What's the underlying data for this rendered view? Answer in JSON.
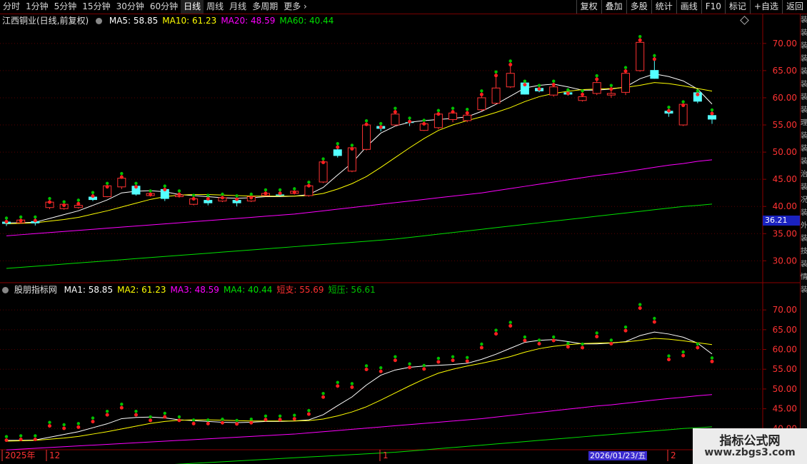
{
  "toolbar": {
    "periods": [
      "分时",
      "1分钟",
      "5分钟",
      "15分钟",
      "30分钟",
      "60分钟",
      "日线",
      "周线",
      "月线",
      "多周期",
      "更多 ›"
    ],
    "active_period": "日线",
    "tools": [
      "复权",
      "叠加",
      "多股",
      "统计",
      "画线",
      "F10",
      "标记",
      "+自选",
      "返回"
    ]
  },
  "main_panel": {
    "title": "江西铜业(日线,前复权)",
    "indicators": [
      {
        "label": "MA5: 58.85",
        "color": "#ffffff"
      },
      {
        "label": "MA10: 61.23",
        "color": "#ffff00"
      },
      {
        "label": "MA20: 48.59",
        "color": "#ff00ff"
      },
      {
        "label": "MA60: 40.44",
        "color": "#00e000"
      }
    ],
    "current_price_label": "36.21"
  },
  "sub_panel": {
    "title": "股朋指标网",
    "indicators": [
      {
        "label": "MA1: 58.85",
        "color": "#ffffff"
      },
      {
        "label": "MA2: 61.23",
        "color": "#ffff00"
      },
      {
        "label": "MA3: 48.59",
        "color": "#ff00ff"
      },
      {
        "label": "MA4: 40.44",
        "color": "#00e000"
      },
      {
        "label": "短支: 55.69",
        "color": "#ff3030"
      },
      {
        "label": "短压: 56.61",
        "color": "#00c000"
      }
    ]
  },
  "time_axis": {
    "labels": [
      "2025年",
      "12",
      "1",
      "2"
    ],
    "crosshair_date": "2026/01/23/五"
  },
  "side_strip_text": [
    "装",
    "装",
    "装",
    "装",
    "装",
    "装",
    "装",
    "装",
    "理",
    "装",
    "装",
    "装",
    "治",
    "装",
    "况",
    "装",
    "外",
    "装",
    "技",
    "装",
    "情",
    "装"
  ],
  "watermark": {
    "line1": "指标公式网",
    "line2": "www.zbgs3.com"
  },
  "colors": {
    "up": "#ff3232",
    "down": "#54ffff",
    "axis_text": "#ff3232",
    "grid": "#5a0000",
    "border": "#8b0000"
  },
  "chart_data": [
    {
      "type": "candlestick",
      "title": "江西铜业(日线,前复权)",
      "ylim": [
        26.5,
        73
      ],
      "yticks": [
        30,
        35,
        40,
        45,
        50,
        55,
        60,
        65,
        70
      ],
      "ohlc": [
        [
          37.2,
          37.6,
          36.4,
          36.8
        ],
        [
          37.0,
          37.8,
          36.8,
          37.5
        ],
        [
          37.3,
          37.8,
          36.5,
          36.9
        ],
        [
          39.8,
          41.2,
          39.5,
          40.8
        ],
        [
          39.6,
          40.6,
          39.4,
          40.4
        ],
        [
          39.8,
          40.9,
          39.6,
          40.2
        ],
        [
          41.8,
          42.3,
          41.0,
          41.2
        ],
        [
          41.8,
          44.0,
          41.7,
          43.8
        ],
        [
          43.6,
          45.8,
          43.2,
          45.2
        ],
        [
          43.8,
          44.0,
          42.0,
          42.2
        ],
        [
          42.0,
          42.6,
          41.8,
          42.4
        ],
        [
          43.2,
          43.5,
          41.0,
          41.4
        ],
        [
          41.8,
          42.6,
          41.6,
          42.1
        ],
        [
          40.4,
          41.8,
          40.2,
          41.4
        ],
        [
          41.2,
          41.8,
          40.2,
          40.6
        ],
        [
          41.0,
          42.0,
          40.8,
          41.6
        ],
        [
          41.2,
          41.7,
          40.0,
          40.6
        ],
        [
          41.0,
          42.0,
          40.8,
          41.8
        ],
        [
          42.0,
          42.8,
          41.9,
          42.4
        ],
        [
          42.2,
          42.8,
          41.8,
          42.0
        ],
        [
          42.4,
          43.0,
          42.2,
          42.8
        ],
        [
          42.0,
          44.2,
          41.8,
          43.8
        ],
        [
          44.5,
          48.5,
          44.3,
          48.2
        ],
        [
          50.5,
          51.3,
          49.0,
          49.3
        ],
        [
          46.5,
          51.0,
          46.3,
          50.8
        ],
        [
          50.5,
          55.5,
          50.3,
          55.0
        ],
        [
          54.8,
          55.0,
          53.8,
          54.3
        ],
        [
          55.0,
          57.8,
          54.8,
          57.0
        ],
        [
          55.5,
          56.0,
          54.8,
          55.4
        ],
        [
          54.0,
          55.6,
          53.9,
          55.2
        ],
        [
          54.5,
          57.4,
          54.2,
          57.0
        ],
        [
          56.0,
          57.8,
          55.5,
          57.2
        ],
        [
          55.8,
          57.6,
          55.5,
          56.8
        ],
        [
          57.8,
          61.0,
          57.5,
          60.0
        ],
        [
          59.0,
          64.5,
          58.8,
          61.8
        ],
        [
          62.0,
          66.5,
          61.8,
          64.5
        ],
        [
          62.8,
          62.8,
          60.6,
          60.6
        ],
        [
          61.8,
          62.0,
          61.0,
          61.2
        ],
        [
          60.5,
          62.8,
          60.2,
          62.0
        ],
        [
          61.0,
          61.2,
          60.4,
          60.6
        ],
        [
          59.5,
          61.0,
          59.3,
          60.2
        ],
        [
          60.8,
          63.8,
          60.5,
          62.8
        ],
        [
          60.5,
          62.0,
          60.0,
          60.8
        ],
        [
          61.0,
          65.3,
          60.5,
          64.5
        ],
        [
          65.0,
          71.0,
          64.8,
          70.2
        ],
        [
          65.1,
          67.5,
          63.5,
          63.5
        ],
        [
          57.6,
          58.0,
          56.5,
          57.1
        ],
        [
          55.0,
          59.0,
          54.8,
          58.8
        ],
        [
          61.0,
          61.0,
          59.0,
          59.3
        ],
        [
          56.8,
          57.5,
          55.2,
          56.0
        ]
      ],
      "ma": [
        {
          "name": "MA5",
          "color": "#ffffff",
          "values": [
            37.0,
            37.0,
            37.1,
            37.8,
            38.5,
            39.2,
            40.2,
            41.2,
            42.5,
            42.8,
            42.9,
            42.7,
            42.2,
            42.0,
            41.8,
            41.6,
            41.5,
            41.6,
            41.8,
            41.8,
            41.9,
            42.2,
            43.5,
            45.8,
            48.0,
            51.0,
            53.5,
            54.8,
            55.5,
            55.8,
            56.0,
            56.2,
            56.5,
            57.5,
            58.8,
            60.3,
            61.8,
            62.3,
            62.5,
            62.0,
            61.4,
            61.4,
            61.6,
            62.0,
            63.5,
            64.4,
            63.9,
            63.1,
            61.6,
            58.85
          ]
        },
        {
          "name": "MA10",
          "color": "#ffff00",
          "values": [
            36.8,
            36.9,
            37.0,
            37.3,
            37.6,
            38.0,
            38.6,
            39.2,
            39.9,
            40.6,
            41.3,
            41.8,
            42.1,
            42.2,
            42.2,
            42.1,
            42.0,
            41.9,
            41.9,
            41.9,
            41.9,
            42.0,
            42.4,
            43.2,
            44.2,
            45.5,
            47.2,
            49.0,
            50.8,
            52.5,
            54.0,
            55.0,
            55.8,
            56.5,
            57.3,
            58.2,
            59.3,
            60.2,
            60.8,
            61.2,
            61.5,
            61.6,
            61.7,
            61.9,
            62.3,
            62.8,
            62.6,
            62.2,
            61.7,
            61.23
          ]
        },
        {
          "name": "MA20",
          "color": "#ff00ff",
          "values": [
            34.6,
            34.8,
            35.0,
            35.2,
            35.4,
            35.6,
            35.8,
            36.0,
            36.2,
            36.4,
            36.6,
            36.8,
            37.0,
            37.2,
            37.4,
            37.6,
            37.8,
            38.0,
            38.2,
            38.4,
            38.6,
            38.9,
            39.2,
            39.5,
            39.8,
            40.1,
            40.4,
            40.7,
            41.0,
            41.3,
            41.6,
            41.9,
            42.2,
            42.5,
            42.9,
            43.3,
            43.7,
            44.1,
            44.5,
            44.9,
            45.3,
            45.7,
            46.0,
            46.4,
            46.8,
            47.2,
            47.6,
            47.9,
            48.3,
            48.59
          ]
        },
        {
          "name": "MA60",
          "color": "#00e000",
          "values": [
            28.6,
            28.8,
            29.0,
            29.2,
            29.4,
            29.6,
            29.8,
            30.0,
            30.2,
            30.4,
            30.6,
            30.8,
            31.0,
            31.2,
            31.4,
            31.6,
            31.8,
            32.0,
            32.2,
            32.4,
            32.6,
            32.8,
            33.0,
            33.2,
            33.4,
            33.6,
            33.8,
            34.0,
            34.3,
            34.6,
            34.9,
            35.2,
            35.5,
            35.8,
            36.1,
            36.4,
            36.7,
            37.0,
            37.3,
            37.6,
            37.9,
            38.2,
            38.5,
            38.8,
            39.1,
            39.4,
            39.7,
            40.0,
            40.2,
            40.44
          ]
        }
      ]
    },
    {
      "type": "line",
      "title": "股朋指标网",
      "ylim": [
        35,
        74
      ],
      "yticks": [
        40,
        45,
        50,
        55,
        60,
        65,
        70
      ],
      "series": [
        {
          "name": "MA1",
          "color": "#ffffff"
        },
        {
          "name": "MA2",
          "color": "#ffff00"
        },
        {
          "name": "MA3",
          "color": "#ff00ff"
        },
        {
          "name": "MA4",
          "color": "#00e000"
        }
      ],
      "markers": "short-term support (短支, red) and resistance (短压, green) dots above each bar"
    }
  ]
}
